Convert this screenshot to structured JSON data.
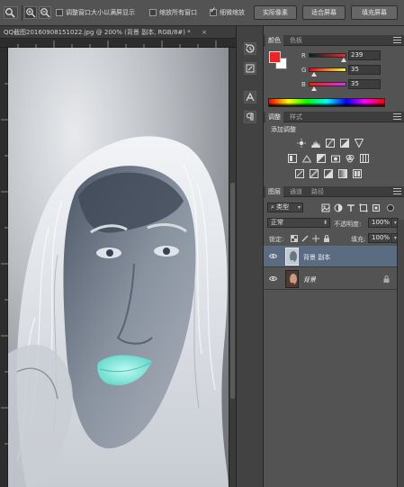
{
  "options_bar": {
    "tool_icon": "zoom-icon",
    "zoom_in_icon": "zoom-in-icon",
    "zoom_out_icon": "zoom-out-icon",
    "resize_windows": {
      "label": "调整窗口大小以满屏显示",
      "checked": false
    },
    "zoom_all_windows": {
      "label": "缩放所有窗口",
      "checked": false
    },
    "scrubby_zoom": {
      "label": "细微缩放",
      "checked": true
    },
    "actual_pixels_label": "实际像素",
    "fit_screen_label": "适合屏幕",
    "fill_screen_label": "填充屏幕"
  },
  "document": {
    "tab_title": "QQ截图20160908151022.jpg @ 200% (背景 副本, RGB/8#) *",
    "close_glyph": "×"
  },
  "tool_strip": {
    "icons": [
      "history-icon",
      "tool-presets-icon",
      "character-icon",
      "paragraph-icon"
    ]
  },
  "color_panel": {
    "tabs": [
      "颜色",
      "色板"
    ],
    "active_tab": 0,
    "foreground_color": "#ef2323",
    "background_color": "#ffffff",
    "channels": [
      {
        "label": "R",
        "value": "239",
        "fraction": 0.937
      },
      {
        "label": "G",
        "value": "35",
        "fraction": 0.137
      },
      {
        "label": "B",
        "value": "35",
        "fraction": 0.137
      }
    ]
  },
  "adjustments_panel": {
    "tabs": [
      "调整",
      "样式"
    ],
    "active_tab": 0,
    "title": "添加调整",
    "row1": [
      "brightness-contrast-icon",
      "levels-icon",
      "curves-icon",
      "exposure-icon",
      "vibrance-icon"
    ],
    "row2": [
      "hue-saturation-icon",
      "color-balance-icon",
      "black-white-icon",
      "photo-filter-icon",
      "channel-mixer-icon",
      "color-lookup-icon"
    ],
    "row3": [
      "invert-icon",
      "posterize-icon",
      "threshold-icon",
      "gradient-map-icon",
      "selective-color-icon"
    ]
  },
  "layers_panel": {
    "tabs": [
      "图层",
      "通道",
      "路径"
    ],
    "active_tab": 0,
    "filter_kind": "类型",
    "blend_mode": "正常",
    "opacity_label": "不透明度:",
    "opacity_value": "100%",
    "lock_label": "锁定:",
    "fill_label": "填充:",
    "fill_value": "100%",
    "layers": [
      {
        "name": "背景 副本",
        "selected": true,
        "visible": true,
        "locked": false
      },
      {
        "name": "背景",
        "selected": false,
        "visible": true,
        "locked": true
      }
    ]
  }
}
